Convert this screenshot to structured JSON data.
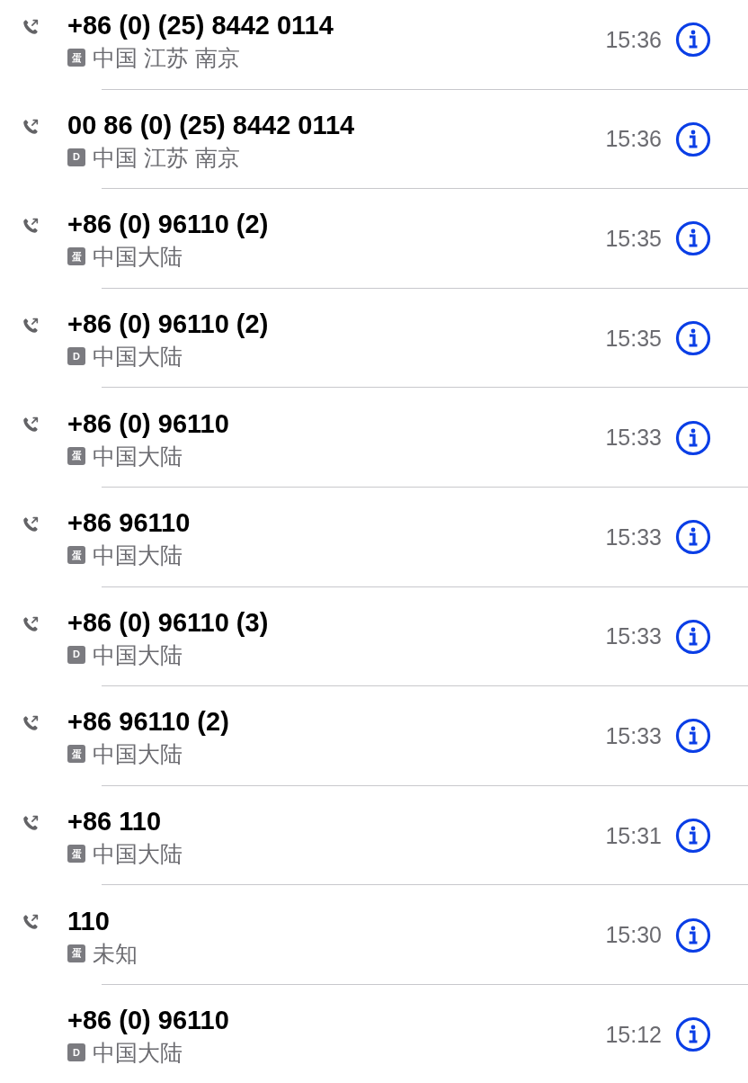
{
  "calls": [
    {
      "number": "+86 (0) (25) 8442 0114",
      "sim": "蛋",
      "location": "中国 江苏 南京",
      "time": "15:36",
      "outgoing": true
    },
    {
      "number": "00 86 (0) (25) 8442 0114",
      "sim": "D",
      "location": "中国 江苏 南京",
      "time": "15:36",
      "outgoing": true
    },
    {
      "number": "+86 (0) 96110 (2)",
      "sim": "蛋",
      "location": "中国大陆",
      "time": "15:35",
      "outgoing": true
    },
    {
      "number": "+86 (0) 96110 (2)",
      "sim": "D",
      "location": "中国大陆",
      "time": "15:35",
      "outgoing": true
    },
    {
      "number": "+86 (0) 96110",
      "sim": "蛋",
      "location": "中国大陆",
      "time": "15:33",
      "outgoing": true
    },
    {
      "number": "+86 96110",
      "sim": "蛋",
      "location": "中国大陆",
      "time": "15:33",
      "outgoing": true
    },
    {
      "number": "+86 (0) 96110 (3)",
      "sim": "D",
      "location": "中国大陆",
      "time": "15:33",
      "outgoing": true
    },
    {
      "number": "+86 96110 (2)",
      "sim": "蛋",
      "location": "中国大陆",
      "time": "15:33",
      "outgoing": true
    },
    {
      "number": "+86 110",
      "sim": "蛋",
      "location": "中国大陆",
      "time": "15:31",
      "outgoing": true
    },
    {
      "number": "110",
      "sim": "蛋",
      "location": "未知",
      "time": "15:30",
      "outgoing": true
    },
    {
      "number": "+86 (0) 96110",
      "sim": "D",
      "location": "中国大陆",
      "time": "15:12",
      "outgoing": false
    }
  ]
}
